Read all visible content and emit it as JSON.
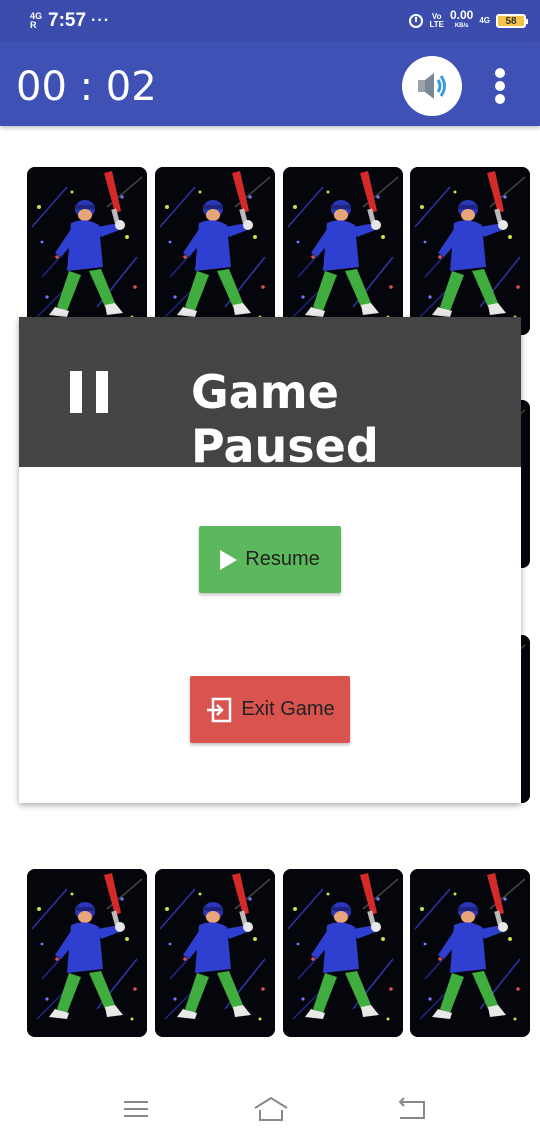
{
  "status_bar": {
    "network_top": "4G",
    "network_bottom": "R",
    "time": "7:57",
    "dots": "···",
    "volte_top": "Vo",
    "volte_bottom": "LTE",
    "speed_value": "0.00",
    "speed_unit": "KB/s",
    "signal_label": "4G",
    "battery": "58"
  },
  "app_bar": {
    "timer": "00 : 02",
    "sound_icon": "speaker-volume-icon",
    "more_icon": "more-vertical-icon"
  },
  "cards": {
    "image": "cricket-batsman-card",
    "count_visible": 8
  },
  "dialog": {
    "title": "Game Paused",
    "pause_icon": "pause-icon",
    "resume_label": "Resume",
    "exit_label": "Exit Game",
    "colors": {
      "header": "#444444",
      "resume": "#5cb85c",
      "exit": "#d9534f"
    }
  },
  "nav_bar": {
    "menu_icon": "menu-icon",
    "home_icon": "home-icon",
    "back_icon": "back-icon"
  },
  "colors": {
    "status_bar": "#3b4cad",
    "app_bar": "#3f51b5"
  }
}
